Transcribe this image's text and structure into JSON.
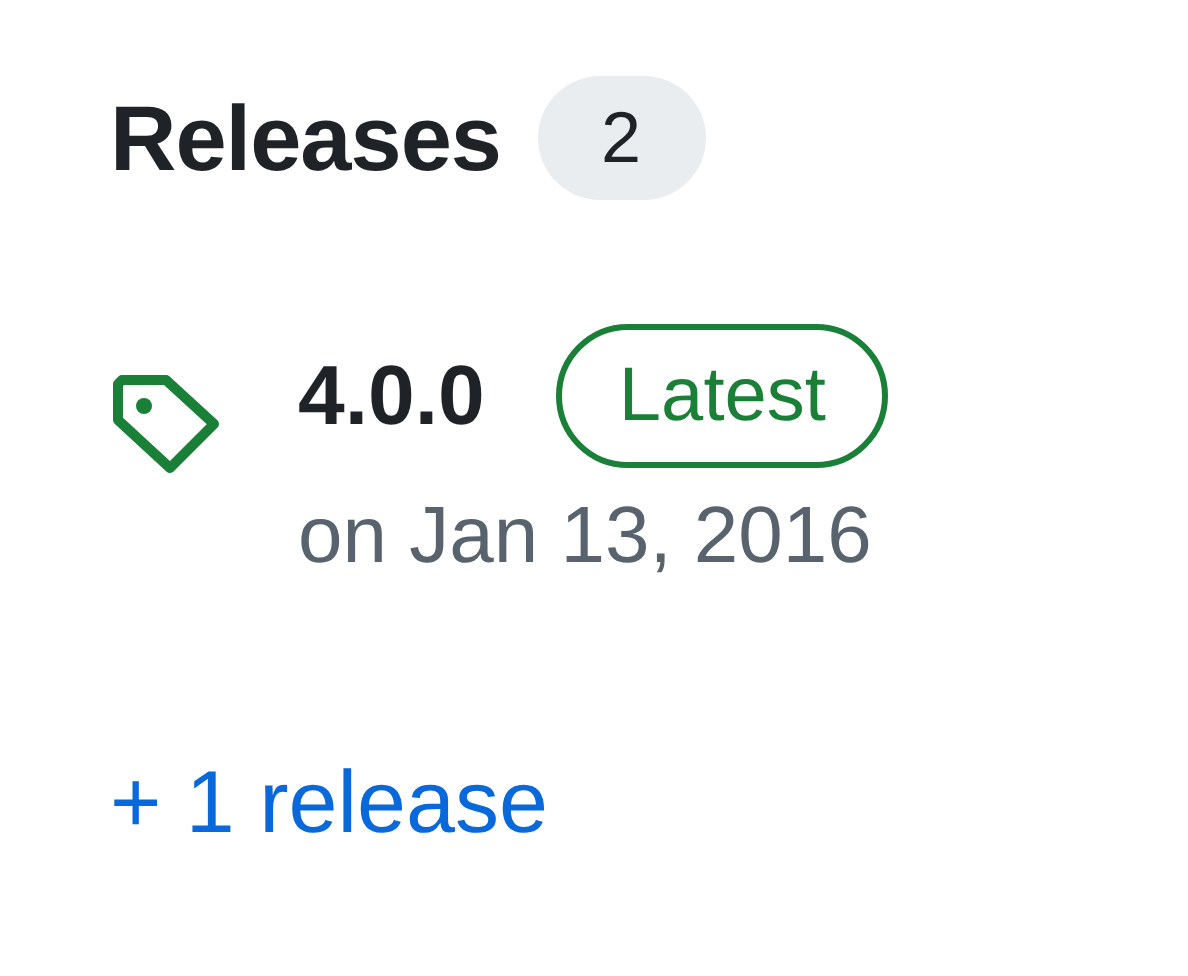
{
  "heading": {
    "title": "Releases",
    "count": "2"
  },
  "latest_release": {
    "version": "4.0.0",
    "badge": "Latest",
    "date": "on Jan 13, 2016"
  },
  "more_link": "+ 1 release"
}
